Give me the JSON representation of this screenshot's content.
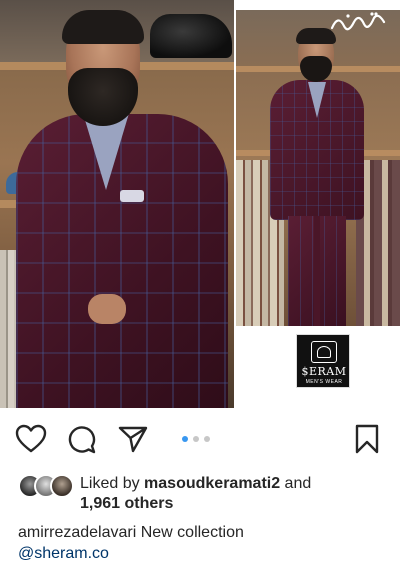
{
  "post": {
    "watermark": "bartarinha",
    "logo": {
      "brand": "$ERAM",
      "tagline": "MEN'S WEAR"
    }
  },
  "actions": {
    "like_icon": "heart-icon",
    "comment_icon": "comment-bubble-icon",
    "share_icon": "paper-plane-icon",
    "save_icon": "bookmark-icon",
    "carousel": {
      "total": 3,
      "active_index": 0
    },
    "colors": {
      "icon": "#262626",
      "active_dot": "#3897f0",
      "inactive_dot": "#c7c7c7"
    }
  },
  "likes": {
    "prefix": "Liked by ",
    "top_user": "masoudkeramati2",
    "joiner": " and",
    "others": "1,961 others"
  },
  "caption": {
    "username": "amirrezadelavari",
    "text": " New collection",
    "mention": "@sheram.co",
    "colors": {
      "mention": "#003569"
    }
  }
}
